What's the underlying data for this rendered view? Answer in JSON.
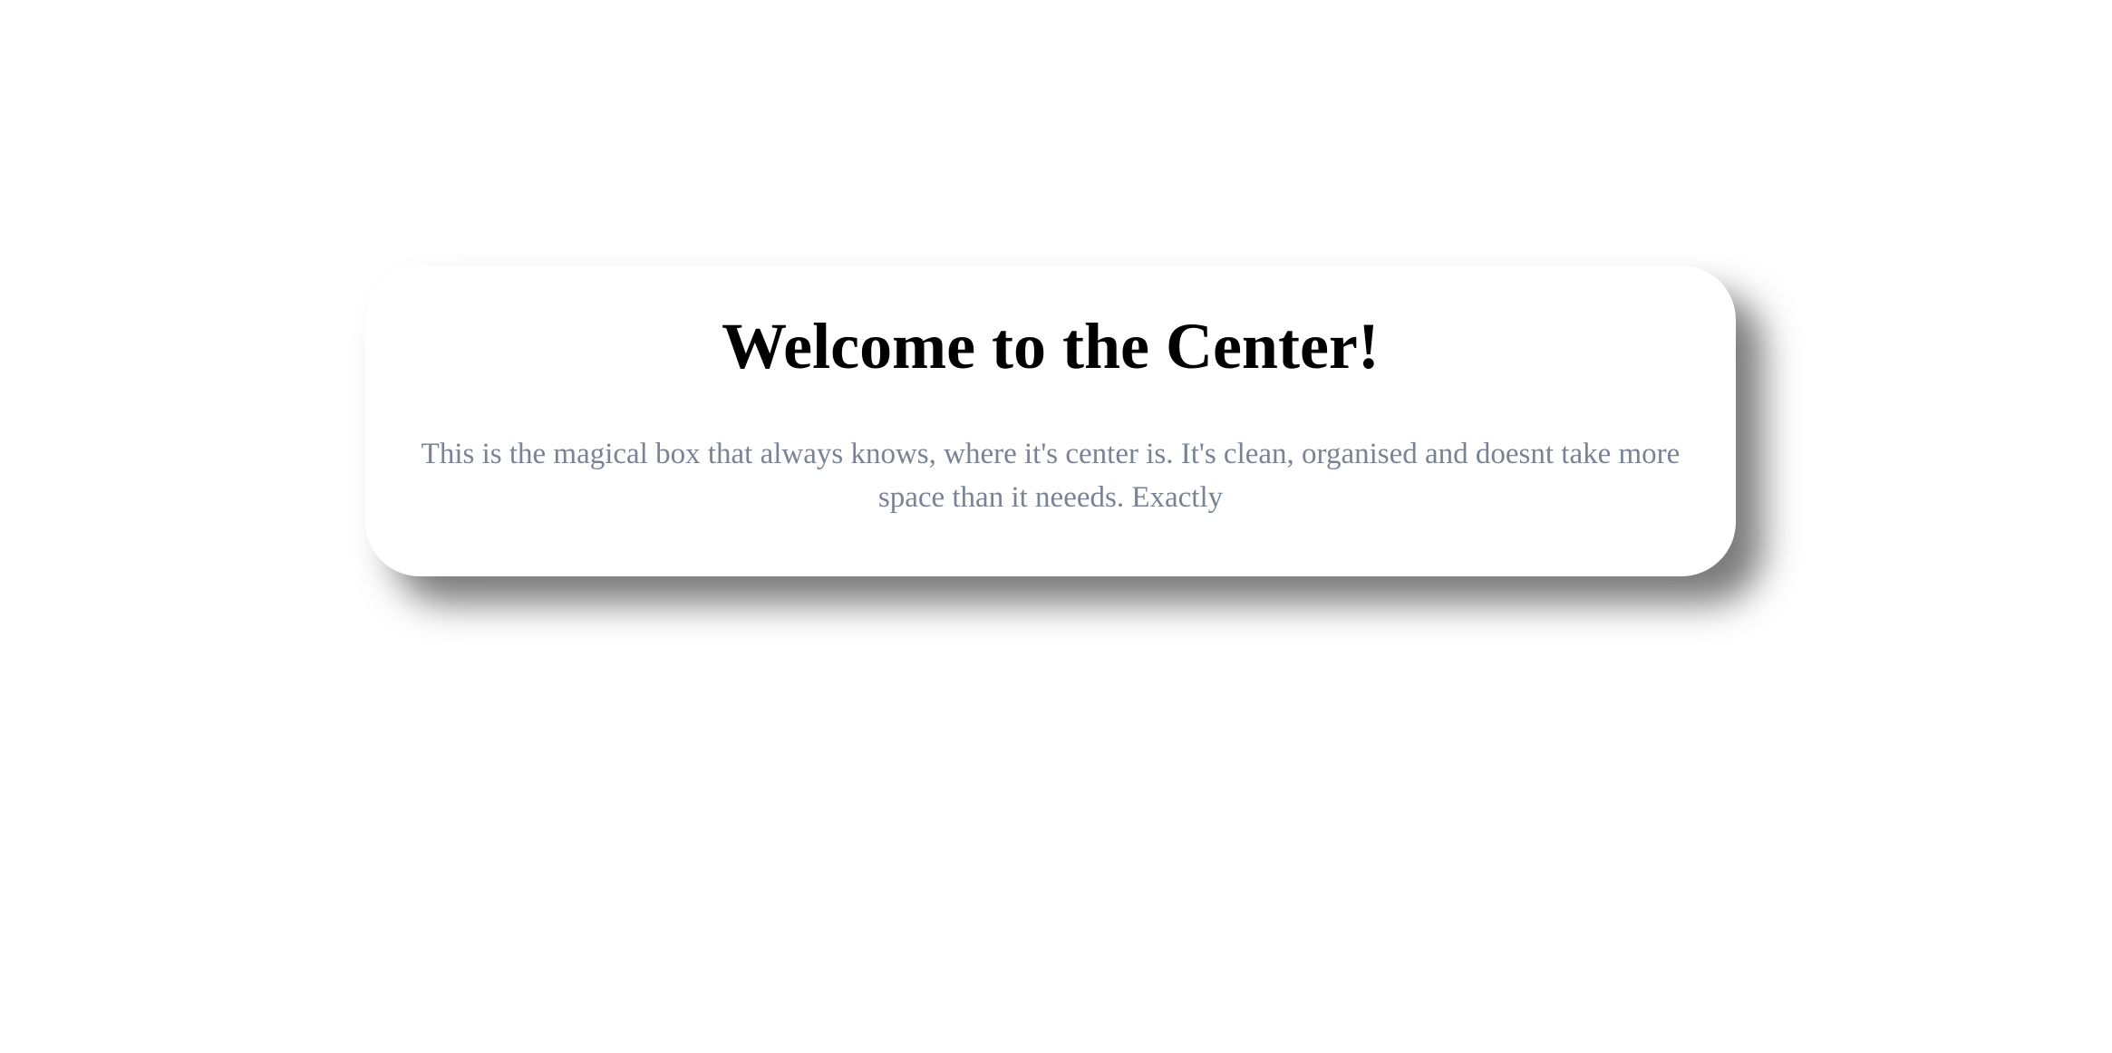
{
  "card": {
    "title": "Welcome to the Center!",
    "description": "This is the magical box that always knows, where it's center is. It's clean, organised and doesnt take more space than it neeeds. Exactly"
  },
  "colors": {
    "background": "#ffffff",
    "card_background": "#ffffff",
    "title_color": "#000000",
    "description_color": "#7a8394"
  }
}
